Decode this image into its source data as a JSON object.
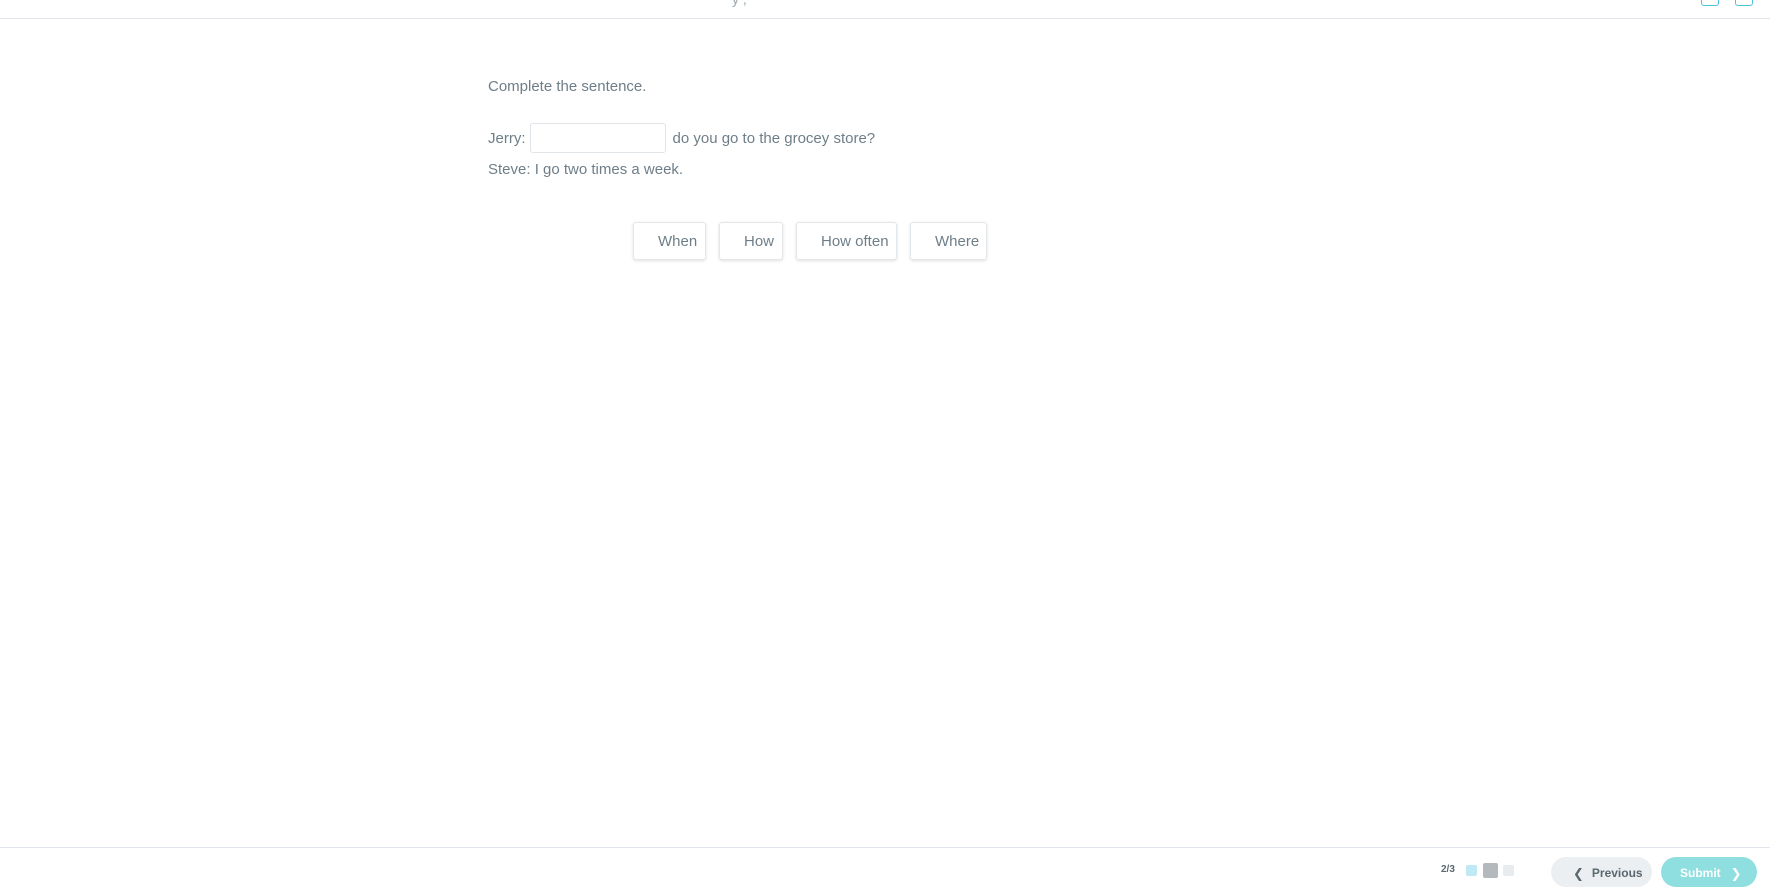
{
  "header": {
    "title_fragment": "y   ,"
  },
  "question": {
    "instruction": "Complete the sentence.",
    "line1_speaker": "Jerry:",
    "line1_rest": "do you go to the grocey store?",
    "line2": "Steve: I go two times a week.",
    "blank_value": ""
  },
  "options": [
    "When",
    "How",
    "How often",
    "Where"
  ],
  "footer": {
    "counter": "2/3",
    "previous_label": "Previous",
    "submit_label": "Submit",
    "prev_chevron": "❮",
    "next_chevron": "❯"
  },
  "colors": {
    "accent": "#4cc4dc",
    "submit_bg": "#8fdfe0",
    "text": "#6e7e88"
  }
}
